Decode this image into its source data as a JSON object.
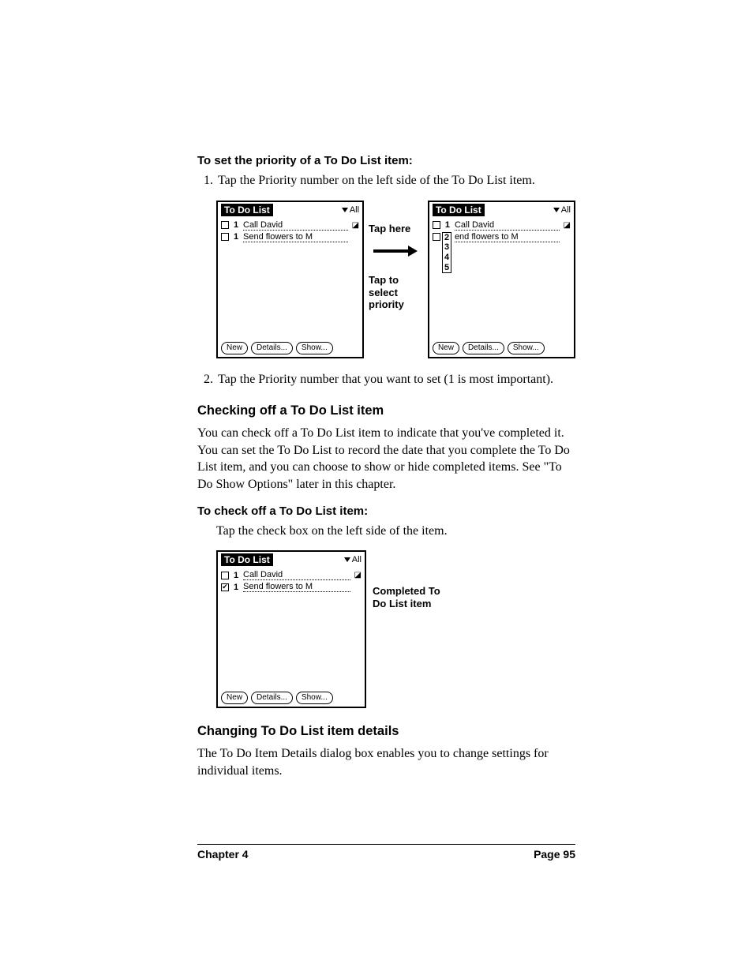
{
  "procedures": {
    "set_priority_head": "To set the priority of a To Do List item:",
    "set_priority_step1": "Tap the Priority number on the left side of the To Do List item.",
    "set_priority_step2": "Tap the Priority number that you want to set (1 is most important).",
    "check_off_head": "To check off a To Do List item:",
    "check_off_body": "Tap the check box on the left side of the item."
  },
  "sections": {
    "checking_head": "Checking off a To Do List item",
    "checking_para": "You can check off a To Do List item to indicate that you've completed it. You can set the To Do List to record the date that you complete the To Do List item, and you can choose to show or hide completed items. See \"To Do Show Options\" later in this chapter.",
    "changing_head": "Changing To Do List item details",
    "changing_para": "The To Do Item Details dialog box enables you to change settings for individual items."
  },
  "callouts": {
    "tap_here": "Tap here",
    "tap_select": "Tap to select priority",
    "completed": "Completed To Do List item"
  },
  "palm": {
    "title": "To Do List",
    "category": "All",
    "item1": "Call David",
    "item2": "Send flowers to M",
    "item2b": "end flowers to M",
    "priority1": "1",
    "popup": [
      "2",
      "3",
      "4",
      "5"
    ],
    "btn_new": "New",
    "btn_details": "Details...",
    "btn_show": "Show..."
  },
  "footer": {
    "chapter": "Chapter 4",
    "page": "Page 95"
  }
}
